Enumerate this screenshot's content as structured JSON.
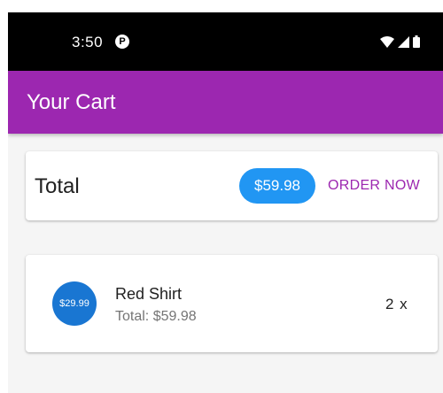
{
  "status_bar": {
    "time": "3:50",
    "notification_icon": "pocket-casts-icon",
    "icons": [
      "wifi-icon",
      "signal-icon",
      "battery-icon"
    ]
  },
  "app_bar": {
    "title": "Your Cart",
    "color": "#9c27b0"
  },
  "summary": {
    "label": "Total",
    "amount": "$59.98",
    "amount_chip_color": "#2196f3",
    "order_button_label": "ORDER NOW"
  },
  "cart_items": [
    {
      "price": "$29.99",
      "name": "Red Shirt",
      "subtotal": "Total: $59.98",
      "quantity": "2 x",
      "avatar_color": "#1976d2"
    }
  ],
  "colors": {
    "background": "#f5f5f5",
    "card": "#ffffff",
    "accent": "#9c27b0"
  }
}
